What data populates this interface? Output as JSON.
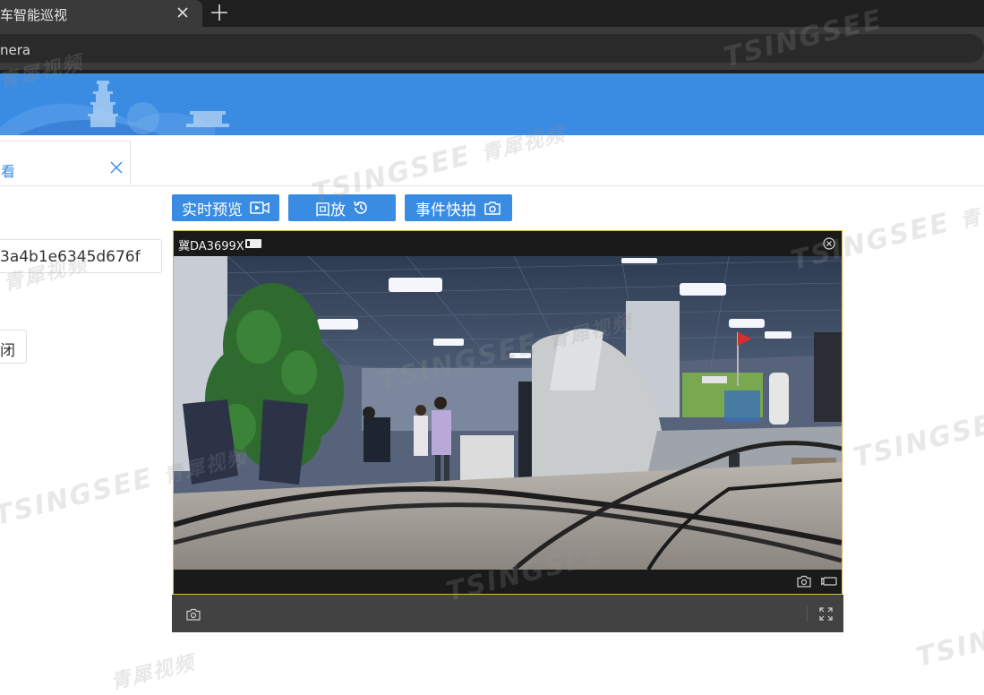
{
  "browser": {
    "tab_title": "车智能巡视",
    "address": "nera"
  },
  "page": {
    "active_tab_label": "看",
    "device_id": "3a4b1e6345d676f",
    "close_button": "闭"
  },
  "actions": {
    "live_preview": "实时预览",
    "playback": "回放",
    "event_snapshot": "事件快拍"
  },
  "player": {
    "plate": "冀DA3699X"
  },
  "watermark": {
    "latin": "TSINGSEE",
    "chinese": "青犀视频"
  },
  "colors": {
    "accent": "#3a8be2",
    "player_border": "#d9b64d"
  }
}
